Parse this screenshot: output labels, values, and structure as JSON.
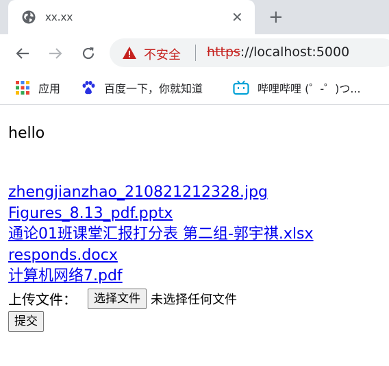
{
  "browser": {
    "tab_title": "xx.xx",
    "security_label": "不安全",
    "url_scheme": "https",
    "url_rest": "://localhost:5000"
  },
  "bookmarks": [
    {
      "label": "应用",
      "icon": "apps-grid-icon"
    },
    {
      "label": "百度一下，你就知道",
      "icon": "baidu-paw-icon"
    },
    {
      "label": "哔哩哔哩 (゜-゜)つ...",
      "icon": "bilibili-tv-icon"
    }
  ],
  "page": {
    "greeting": "hello",
    "files": [
      "zhengjianzhao_210821212328.jpg",
      "Figures_8.13_pdf.pptx",
      "通论01班课堂汇报打分表 第二组-郭宇祺.xlsx",
      "responds.docx",
      "计算机网络7.pdf"
    ],
    "upload_label": "上传文件：",
    "choose_file_button": "选择文件",
    "no_file_text": "未选择任何文件",
    "submit_button": "提交"
  },
  "colors": {
    "link": "#0000ee",
    "insecure_red": "#c5221f",
    "chrome_frame": "#dee1e6"
  }
}
